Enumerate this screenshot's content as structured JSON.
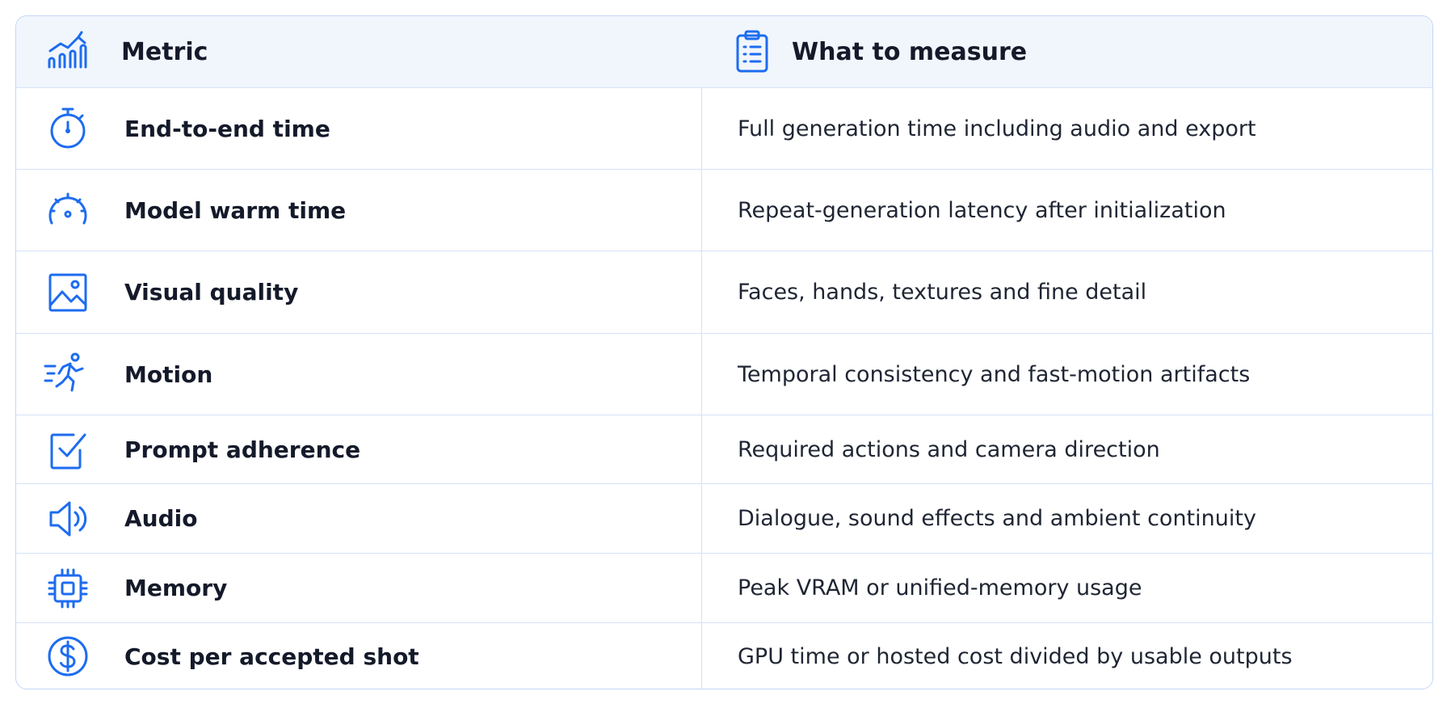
{
  "header": {
    "metric_label": "Metric",
    "measure_label": "What to measure",
    "metric_icon": "chart-trend-icon",
    "measure_icon": "clipboard-list-icon"
  },
  "rows": [
    {
      "metric": "End-to-end time",
      "measure": "Full generation time including audio and export",
      "icon": "stopwatch-icon"
    },
    {
      "metric": "Model warm time",
      "measure": "Repeat-generation latency after initialization",
      "icon": "speedometer-icon"
    },
    {
      "metric": "Visual quality",
      "measure": "Faces, hands, textures and fine detail",
      "icon": "image-icon"
    },
    {
      "metric": "Motion",
      "measure": "Temporal consistency and fast-motion artifacts",
      "icon": "running-person-icon"
    },
    {
      "metric": "Prompt adherence",
      "measure": "Required actions and camera direction",
      "icon": "checkbox-icon"
    },
    {
      "metric": "Audio",
      "measure": "Dialogue, sound effects and ambient continuity",
      "icon": "speaker-icon"
    },
    {
      "metric": "Memory",
      "measure": "Peak VRAM or unified-memory usage",
      "icon": "chip-icon"
    },
    {
      "metric": "Cost per accepted shot",
      "measure": "GPU time or hosted cost divided by usable outputs",
      "icon": "dollar-coin-icon"
    }
  ],
  "colors": {
    "accent": "#1d6cf0",
    "border": "#c4d6f5",
    "header_bg": "#f1f6fd",
    "text": "#141a2a"
  }
}
